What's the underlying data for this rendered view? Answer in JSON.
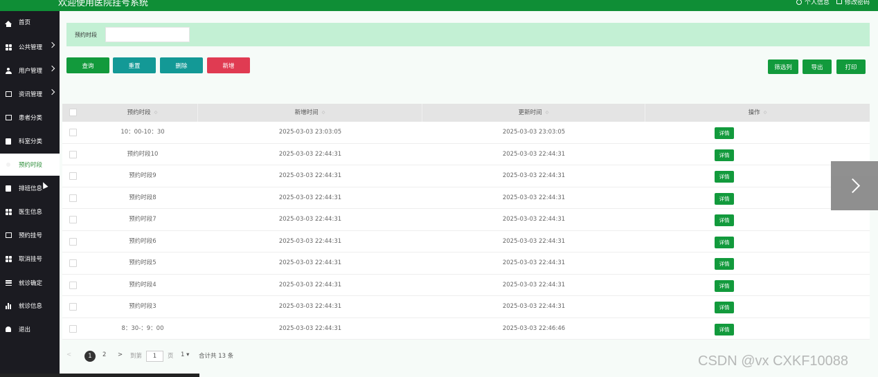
{
  "header": {
    "title": "欢迎使用医院挂号系统",
    "profile_label": "个人信息",
    "password_label": "修改密码"
  },
  "sidebar": {
    "items": [
      {
        "label": "首页"
      },
      {
        "label": "公共管理"
      },
      {
        "label": "用户管理"
      },
      {
        "label": "资讯管理"
      },
      {
        "label": "患者分类"
      },
      {
        "label": "科室分类"
      },
      {
        "label": "预约时段"
      },
      {
        "label": "排班信息"
      },
      {
        "label": "医生信息"
      },
      {
        "label": "预约挂号"
      },
      {
        "label": "取消挂号"
      },
      {
        "label": "就诊确定"
      },
      {
        "label": "就诊信息"
      },
      {
        "label": "退出"
      }
    ],
    "active": "预约时段"
  },
  "search": {
    "label": "预约时段",
    "value": ""
  },
  "toolbar": {
    "query": "查询",
    "reset": "重置",
    "delete": "删除",
    "add": "新增",
    "filter_columns": "筛选列",
    "export": "导出",
    "print": "打印"
  },
  "table": {
    "columns": [
      "预约时段",
      "新增时间",
      "更新时间",
      "操作"
    ],
    "detail_label": "详情",
    "rows": [
      {
        "slot": "10：00-10：30",
        "created": "2025-03-03 23:03:05",
        "updated": "2025-03-03 23:03:05"
      },
      {
        "slot": "预约时段10",
        "created": "2025-03-03 22:44:31",
        "updated": "2025-03-03 22:44:31"
      },
      {
        "slot": "预约时段9",
        "created": "2025-03-03 22:44:31",
        "updated": "2025-03-03 22:44:31"
      },
      {
        "slot": "预约时段8",
        "created": "2025-03-03 22:44:31",
        "updated": "2025-03-03 22:44:31"
      },
      {
        "slot": "预约时段7",
        "created": "2025-03-03 22:44:31",
        "updated": "2025-03-03 22:44:31"
      },
      {
        "slot": "预约时段6",
        "created": "2025-03-03 22:44:31",
        "updated": "2025-03-03 22:44:31"
      },
      {
        "slot": "预约时段5",
        "created": "2025-03-03 22:44:31",
        "updated": "2025-03-03 22:44:31"
      },
      {
        "slot": "预约时段4",
        "created": "2025-03-03 22:44:31",
        "updated": "2025-03-03 22:44:31"
      },
      {
        "slot": "预约时段3",
        "created": "2025-03-03 22:44:31",
        "updated": "2025-03-03 22:44:31"
      },
      {
        "slot": "8：30-：9：00",
        "created": "2025-03-03 22:44:31",
        "updated": "2025-03-03 22:46:46"
      }
    ]
  },
  "pagination": {
    "prev": "<",
    "current": "1",
    "page2": "2",
    "next": ">",
    "goto_label": "到第",
    "goto_value": "1",
    "page_unit": "页",
    "page_size": "1",
    "total": "合计共 13 条"
  },
  "watermark": "CSDN @vx  CXKF10088",
  "colors": {
    "primary_green": "#0f8e36",
    "teal": "#139996",
    "red": "#e03b52",
    "search_bg": "#c3f0d4",
    "sidebar_bg": "#1b1b21"
  }
}
